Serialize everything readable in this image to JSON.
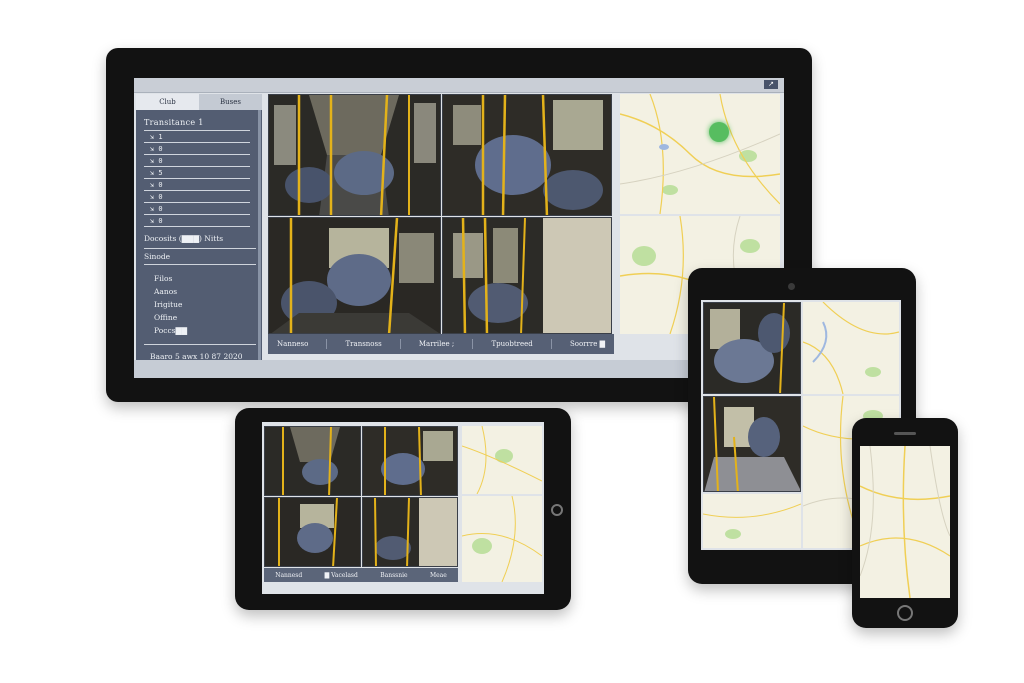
{
  "monitor": {
    "topbar": {
      "corner_button_label": "↗"
    },
    "sidebar": {
      "tabs": [
        {
          "label": "Club",
          "active": true
        },
        {
          "label": "Buses",
          "active": false
        }
      ],
      "title": "Transitance 1",
      "rows": [
        "⇲ 1",
        "⇲ 0",
        "⇲ 0",
        "⇲ 5",
        "⇲ 0",
        "⇲ 0",
        "⇲ 0",
        "⇲ 0"
      ],
      "section_label": "Docosits (▇▇▇) Nitts",
      "group_label": "Sinode",
      "menu_items": [
        "Filos",
        "Aanos",
        "Irigitue",
        "Offine",
        "Poccs▇▇"
      ],
      "footer": "Baaro 5 awx 10 87 2020"
    },
    "statusbar": {
      "items": [
        "Nanneso",
        "Transnoss",
        "Marrilee ;",
        "Tpuobtreed",
        "Soorrre ▇"
      ]
    }
  },
  "tablet_landscape": {
    "statusbar": {
      "items": [
        "Nannesd",
        "▇ Vacelasd",
        "Banssnie",
        "Meae"
      ]
    }
  },
  "tablet_portrait": {},
  "phone": {},
  "colors": {
    "bezel": "#121212",
    "ui_panel": "#535d72",
    "map_background": "#f3f1e3",
    "map_road": "#f0cf55",
    "map_green": "#bfe0a1",
    "map_water": "#9fb8e0",
    "map_marker": "#3cb54a",
    "bus_pole": "#e3b21a"
  }
}
